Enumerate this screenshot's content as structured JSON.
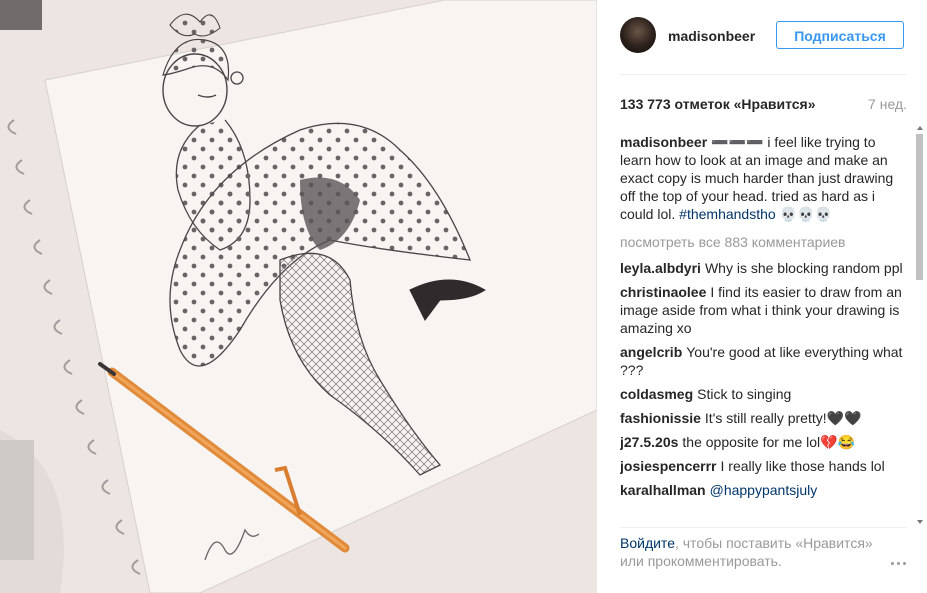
{
  "post": {
    "username": "madisonbeer",
    "follow_label": "Подписаться",
    "likes": "133 773 отметок «Нравится»",
    "age": "7 нед.",
    "caption_user": "madisonbeer",
    "caption_text": "➖➖➖ i feel like trying to learn how to look at an image and make an exact copy is much harder than just drawing off the top of your head. tried as hard as i could lol.",
    "caption_hashtag": "#themhandstho",
    "caption_emoji": "💀💀💀",
    "view_all": "посмотреть все 883 комментариев"
  },
  "comments": [
    {
      "user": "leyla.albdyri",
      "text": "Why is she blocking random ppl"
    },
    {
      "user": "christinaolee",
      "text": "I find its easier to draw from an image aside from what i think your drawing is amazing xo"
    },
    {
      "user": "angelcrib",
      "text": "You're good at like everything what ???"
    },
    {
      "user": "coldasmeg",
      "text": "Stick to singing"
    },
    {
      "user": "fashionissie",
      "text": "It's still really pretty!🖤🖤"
    },
    {
      "user": "j27.5.20s",
      "text": "the opposite for me lol💔😂"
    },
    {
      "user": "josiespencerrr",
      "text": "I really like those hands lol"
    },
    {
      "user": "karalhallman",
      "text": "@happypantsjuly"
    }
  ],
  "footer": {
    "login_label": "Войдите",
    "rest": ", чтобы поставить «Нравится» или прокомментировать."
  },
  "icons": {
    "more": "more-options-icon",
    "avatar": "profile-avatar"
  },
  "colors": {
    "link": "#3897f0",
    "hashtag": "#003569",
    "muted": "#999999"
  }
}
